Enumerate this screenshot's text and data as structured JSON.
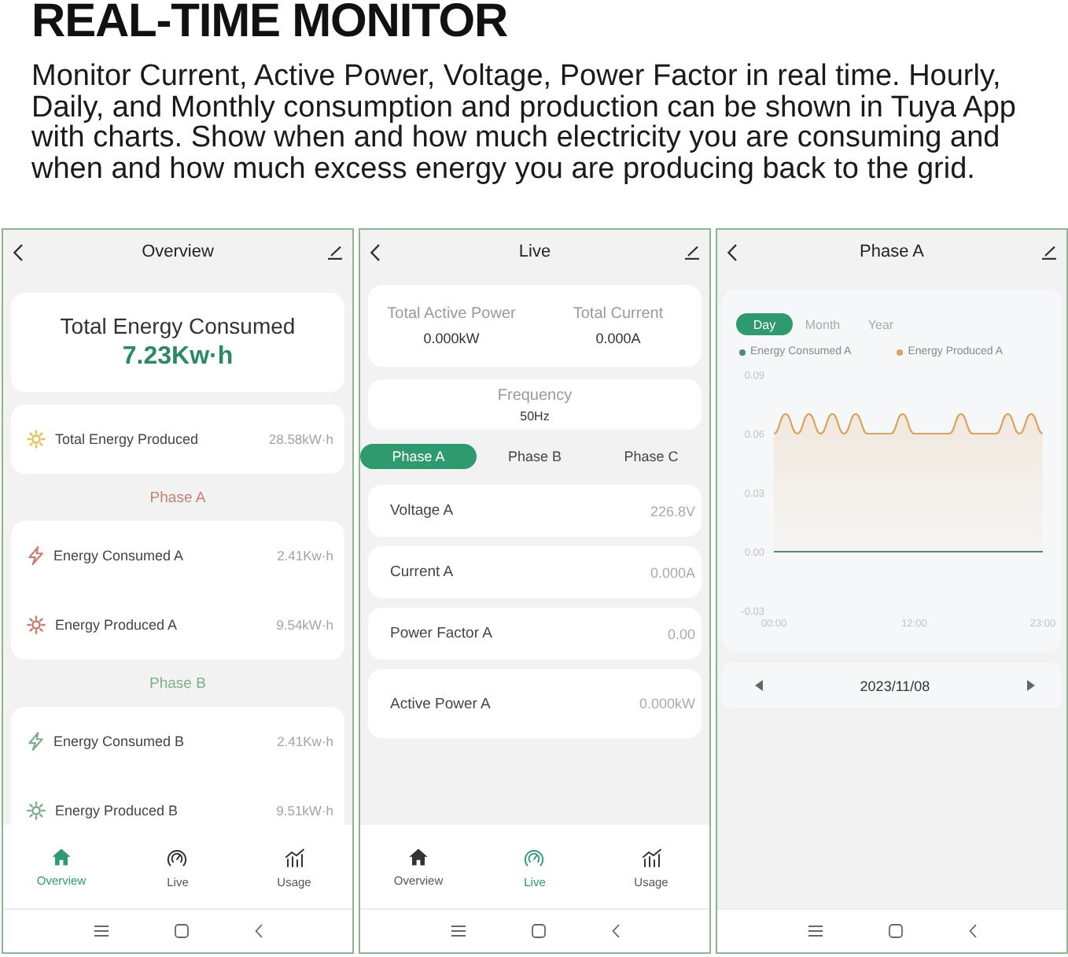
{
  "header": {
    "title": "REAL-TIME MONITOR",
    "description": "Monitor Current, Active Power, Voltage, Power Factor in real time. Hourly, Daily, and Monthly consumption and production can be shown in Tuya App with charts. Show when and how much electricity you are consuming and when and how much excess energy you are producing back to the grid."
  },
  "screens": [
    {
      "kind": "overview",
      "title": "Overview",
      "summary": {
        "label": "Total Energy Consumed",
        "value": "7.23Kw·h"
      },
      "total": {
        "kind": "produced",
        "label": "Total Energy Produced",
        "value": "28.58kW·h",
        "color": "#e2c35e"
      },
      "phases": [
        {
          "title": "Phase A",
          "color": "#c4806f",
          "rows": [
            {
              "kind": "consumed",
              "label": "Energy Consumed A",
              "value": "2.41Kw·h"
            },
            {
              "kind": "produced",
              "label": "Energy Produced A",
              "value": "9.54kW·h"
            }
          ]
        },
        {
          "title": "Phase B",
          "color": "#7fae8c",
          "rows": [
            {
              "kind": "consumed",
              "label": "Energy Consumed B",
              "value": "2.41Kw·h"
            },
            {
              "kind": "produced",
              "label": "Energy Produced B",
              "value": "9.51kW·h"
            }
          ]
        }
      ],
      "nav": [
        {
          "kind": "home",
          "label": "Overview",
          "selected": true
        },
        {
          "kind": "gauge",
          "label": "Live",
          "selected": false
        },
        {
          "kind": "chart",
          "label": "Usage",
          "selected": false
        }
      ]
    },
    {
      "kind": "live",
      "title": "Live",
      "totals": [
        {
          "label": "Total Active Power",
          "value": "0.000kW"
        },
        {
          "label": "Total Current",
          "value": "0.000A"
        }
      ],
      "frequency": {
        "label": "Frequency",
        "value": "50Hz"
      },
      "tabs": [
        {
          "label": "Phase A",
          "selected": true
        },
        {
          "label": "Phase B",
          "selected": false
        },
        {
          "label": "Phase C",
          "selected": false
        }
      ],
      "readings": [
        {
          "label": "Voltage A",
          "value": "226.8V"
        },
        {
          "label": "Current A",
          "value": "0.000A"
        },
        {
          "label": "Power Factor A",
          "value": "0.00"
        },
        {
          "label": "Active Power A",
          "value": "0.000kW"
        }
      ],
      "nav": [
        {
          "kind": "home",
          "label": "Overview",
          "selected": false
        },
        {
          "kind": "gauge",
          "label": "Live",
          "selected": true
        },
        {
          "kind": "chart",
          "label": "Usage",
          "selected": false
        }
      ]
    },
    {
      "kind": "phase",
      "title": "Phase A",
      "ranges": [
        {
          "label": "Day",
          "selected": true
        },
        {
          "label": "Month",
          "selected": false
        },
        {
          "label": "Year",
          "selected": false
        }
      ],
      "chart_data": {
        "type": "line",
        "x": [
          0,
          1,
          2,
          3,
          4,
          5,
          6,
          7,
          8,
          9,
          10,
          11,
          12,
          13,
          14,
          15,
          16,
          17,
          18,
          19,
          20,
          21,
          22,
          23
        ],
        "series": [
          {
            "name": "Energy Consumed A",
            "color": "#4f8a74",
            "values": [
              0,
              0,
              0,
              0,
              0,
              0,
              0,
              0,
              0,
              0,
              0,
              0,
              0,
              0,
              0,
              0,
              0,
              0,
              0,
              0,
              0,
              0,
              0,
              0
            ]
          },
          {
            "name": "Energy Produced A",
            "color": "#d9a45e",
            "values": [
              0.06,
              0.07,
              0.06,
              0.07,
              0.06,
              0.07,
              0.06,
              0.07,
              0.06,
              0.06,
              0.06,
              0.07,
              0.06,
              0.06,
              0.06,
              0.06,
              0.07,
              0.06,
              0.06,
              0.06,
              0.07,
              0.06,
              0.07,
              0.06
            ]
          }
        ],
        "xlim": [
          0,
          23
        ],
        "ylim": [
          -0.03,
          0.09
        ],
        "xticks": [
          {
            "value": 0,
            "label": "00:00"
          },
          {
            "value": 12,
            "label": "12:00"
          },
          {
            "value": 23,
            "label": "23:00"
          }
        ],
        "yticks": [
          {
            "value": 0.09,
            "label": "0.09"
          },
          {
            "value": 0.06,
            "label": "0.06"
          },
          {
            "value": 0.03,
            "label": "0.03"
          },
          {
            "value": 0,
            "label": "0.00"
          },
          {
            "value": -0.03,
            "label": "-0.03"
          }
        ]
      },
      "date": "2023/11/08"
    }
  ]
}
